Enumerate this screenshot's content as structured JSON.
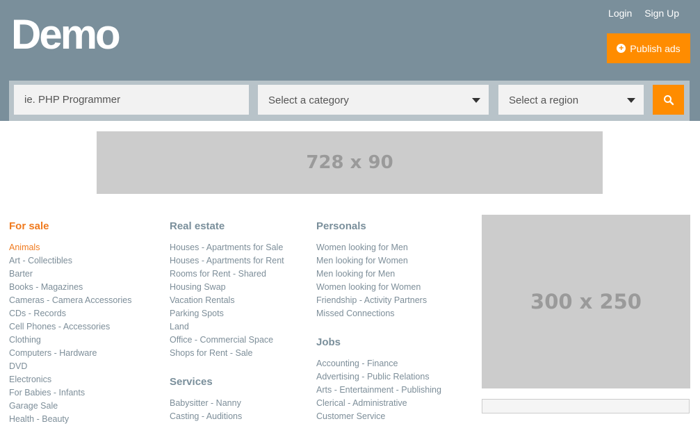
{
  "header": {
    "logo": "Demo",
    "login_label": "Login",
    "signup_label": "Sign Up",
    "publish_label": "Publish ads",
    "brand_color": "#7a8f9b",
    "accent_color": "#ff8c00"
  },
  "search": {
    "placeholder": "ie. PHP Programmer",
    "category_label": "Select a category",
    "region_label": "Select a region",
    "search_icon": "search-icon"
  },
  "ads": {
    "top_banner": "728 x 90",
    "side_banner": "300 x 250"
  },
  "columns": [
    {
      "title": "For sale",
      "items": [
        "Animals",
        "Art - Collectibles",
        "Barter",
        "Books - Magazines",
        "Cameras - Camera Accessories",
        "CDs - Records",
        "Cell Phones - Accessories",
        "Clothing",
        "Computers - Hardware",
        "DVD",
        "Electronics",
        "For Babies - Infants",
        "Garage Sale",
        "Health - Beauty"
      ]
    },
    {
      "title": "Real estate",
      "items": [
        "Houses - Apartments for Sale",
        "Houses - Apartments for Rent",
        "Rooms for Rent - Shared",
        "Housing Swap",
        "Vacation Rentals",
        "Parking Spots",
        "Land",
        "Office - Commercial Space",
        "Shops for Rent - Sale"
      ],
      "sub_title": "Services",
      "sub_items": [
        "Babysitter - Nanny",
        "Casting - Auditions"
      ]
    },
    {
      "title": "Personals",
      "items": [
        "Women looking for Men",
        "Men looking for Women",
        "Men looking for Men",
        "Women looking for Women",
        "Friendship - Activity Partners",
        "Missed Connections"
      ],
      "sub_title": "Jobs",
      "sub_items": [
        "Accounting - Finance",
        "Advertising - Public Relations",
        "Arts - Entertainment - Publishing",
        "Clerical - Administrative",
        "Customer Service"
      ]
    }
  ]
}
